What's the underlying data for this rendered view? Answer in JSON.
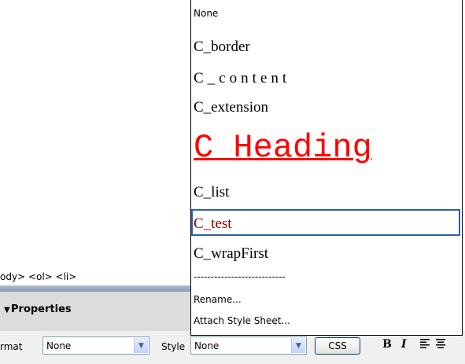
{
  "tag_selector": {
    "text": "ody> <ol> <li>"
  },
  "properties_panel": {
    "title": "Properties",
    "format_label": "rmat",
    "format_value": "None",
    "style_label": "Style",
    "style_value": "None",
    "css_button": "CSS",
    "bold_label": "B",
    "italic_label": "I"
  },
  "style_dropdown": {
    "items": [
      {
        "label": "None"
      },
      {
        "label": "C_border"
      },
      {
        "label": "C_content"
      },
      {
        "label": "C_extension"
      },
      {
        "label": "C Heading"
      },
      {
        "label": "C_list"
      },
      {
        "label": "C_test",
        "selected": true
      },
      {
        "label": "C_wrapFirst"
      }
    ],
    "separator": "---------------------------",
    "rename": "Rename...",
    "attach": "Attach Style Sheet..."
  },
  "colors": {
    "heading_red": "#ff0000",
    "selected_text": "#8b0000",
    "selection_border": "#2e5fa6"
  },
  "icons": [
    "collapse-arrow-icon",
    "dropdown-arrow-icon",
    "align-left-icon",
    "align-center-icon"
  ]
}
